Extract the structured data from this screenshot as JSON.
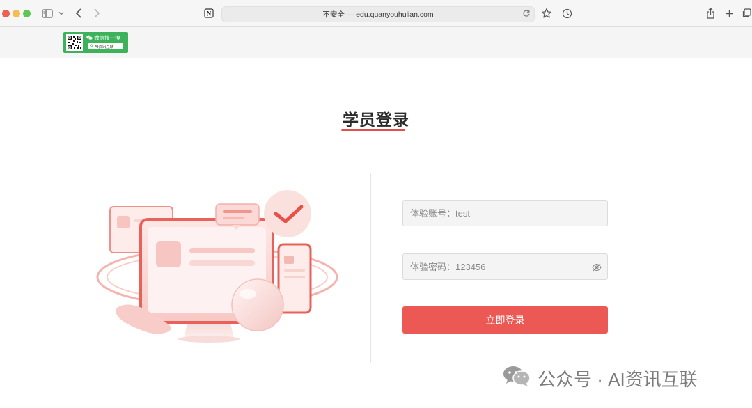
{
  "browser": {
    "address_text": "不安全 — edu.quanyouhulian.com"
  },
  "badge": {
    "wechat_label": "微信搜一搜",
    "search_text": "AI资讯互联"
  },
  "login": {
    "title": "学员登录",
    "account_placeholder": "体验账号：test",
    "password_placeholder": "体验密码：123456",
    "submit_label": "立即登录"
  },
  "watermark": {
    "text": "公众号 · AI资讯互联"
  },
  "colors": {
    "accent": "#ec5954",
    "title_underline": "#e74c4c",
    "badge_green": "#3cb35a"
  },
  "icons": [
    "sidebar-icon",
    "chevron-down-icon",
    "back-icon",
    "forward-icon",
    "notion-icon",
    "reload-icon",
    "star-icon",
    "history-icon",
    "share-icon",
    "new-tab-icon",
    "tabs-overview-icon",
    "eye-slash-icon",
    "wechat-icon"
  ]
}
